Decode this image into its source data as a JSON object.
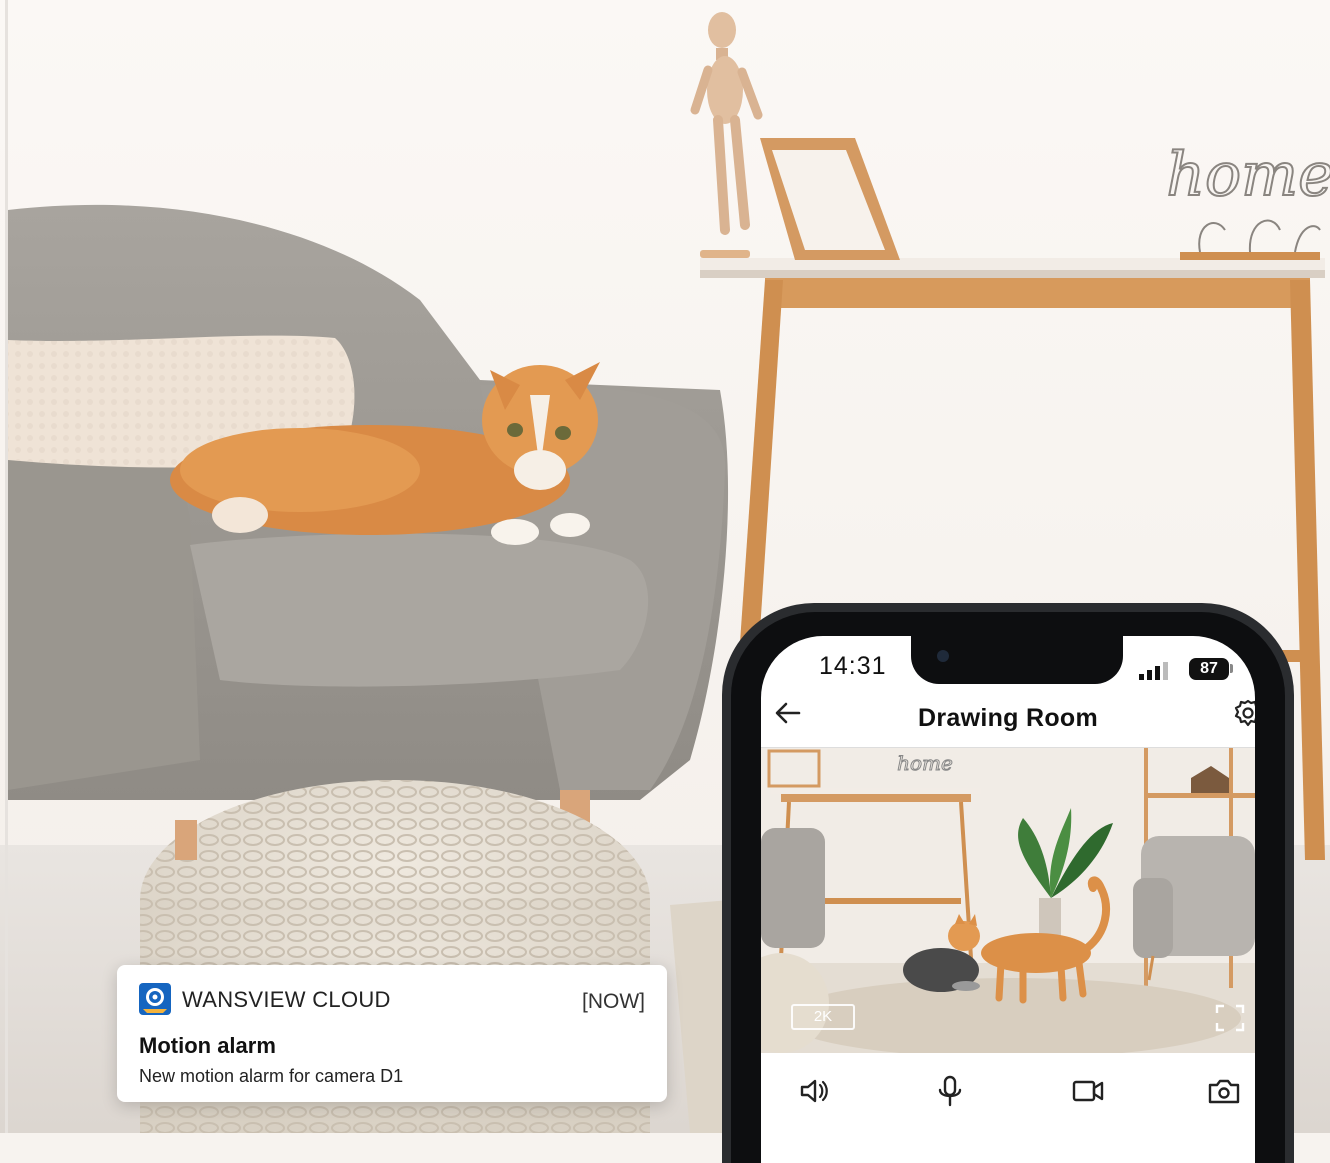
{
  "notification": {
    "app_name": "WANSVIEW CLOUD",
    "time": "[NOW]",
    "title": "Motion alarm",
    "body": "New motion alarm for camera D1"
  },
  "phone": {
    "status_time": "14:31",
    "battery": "87",
    "header": {
      "title": "Drawing Room"
    },
    "feed": {
      "quality": "2K"
    },
    "icons": {
      "back": "back-arrow-icon",
      "settings": "gear-icon",
      "speaker": "speaker-icon",
      "microphone": "microphone-icon",
      "record": "video-record-icon",
      "snapshot": "camera-snapshot-icon",
      "fullscreen": "fullscreen-icon"
    }
  },
  "decor": {
    "home_sign": "home"
  },
  "colors": {
    "accent": "#2a2c2f",
    "app_icon_blue": "#1565c0"
  }
}
